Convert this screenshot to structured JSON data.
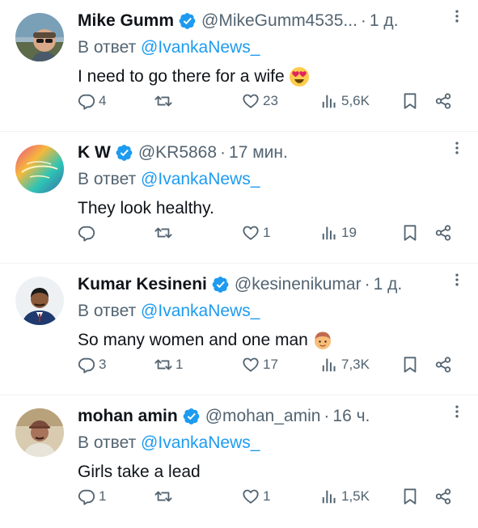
{
  "tweets": [
    {
      "name": "Mike Gumm",
      "handle": "@MikeGumm4535...",
      "time": "1 д.",
      "reply_prefix": "В ответ",
      "reply_handle": "@IvankaNews_",
      "text": "I need to go there for a wife",
      "emoji": "heart-eyes",
      "replies": "4",
      "retweets": "",
      "likes": "23",
      "views": "5,6K"
    },
    {
      "name": "K W",
      "handle": "@KR5868",
      "time": "17 мин.",
      "reply_prefix": "В ответ",
      "reply_handle": "@IvankaNews_",
      "text": "They look healthy.",
      "emoji": "",
      "replies": "",
      "retweets": "",
      "likes": "1",
      "views": "19"
    },
    {
      "name": "Kumar Kesineni",
      "handle": "@kesinenikumar",
      "time": "1 д.",
      "reply_prefix": "В ответ",
      "reply_handle": "@IvankaNews_",
      "text": "So many women and one man",
      "emoji": "man-face",
      "replies": "3",
      "retweets": "1",
      "likes": "17",
      "views": "7,3K"
    },
    {
      "name": "mohan amin",
      "handle": "@mohan_amin",
      "time": "16 ч.",
      "reply_prefix": "В ответ",
      "reply_handle": "@IvankaNews_",
      "text": "Girls take a lead",
      "emoji": "",
      "replies": "1",
      "retweets": "",
      "likes": "1",
      "views": "1,5K"
    }
  ],
  "icons": {
    "verified": "verified-badge-icon",
    "reply": "reply-icon",
    "retweet": "retweet-icon",
    "like": "heart-icon",
    "views": "views-icon",
    "bookmark": "bookmark-icon",
    "share": "share-icon",
    "more": "more-icon"
  },
  "colors": {
    "accent": "#1d9bf0",
    "secondary_text": "#536471",
    "primary_text": "#0f1419",
    "divider": "#eff3f4"
  }
}
